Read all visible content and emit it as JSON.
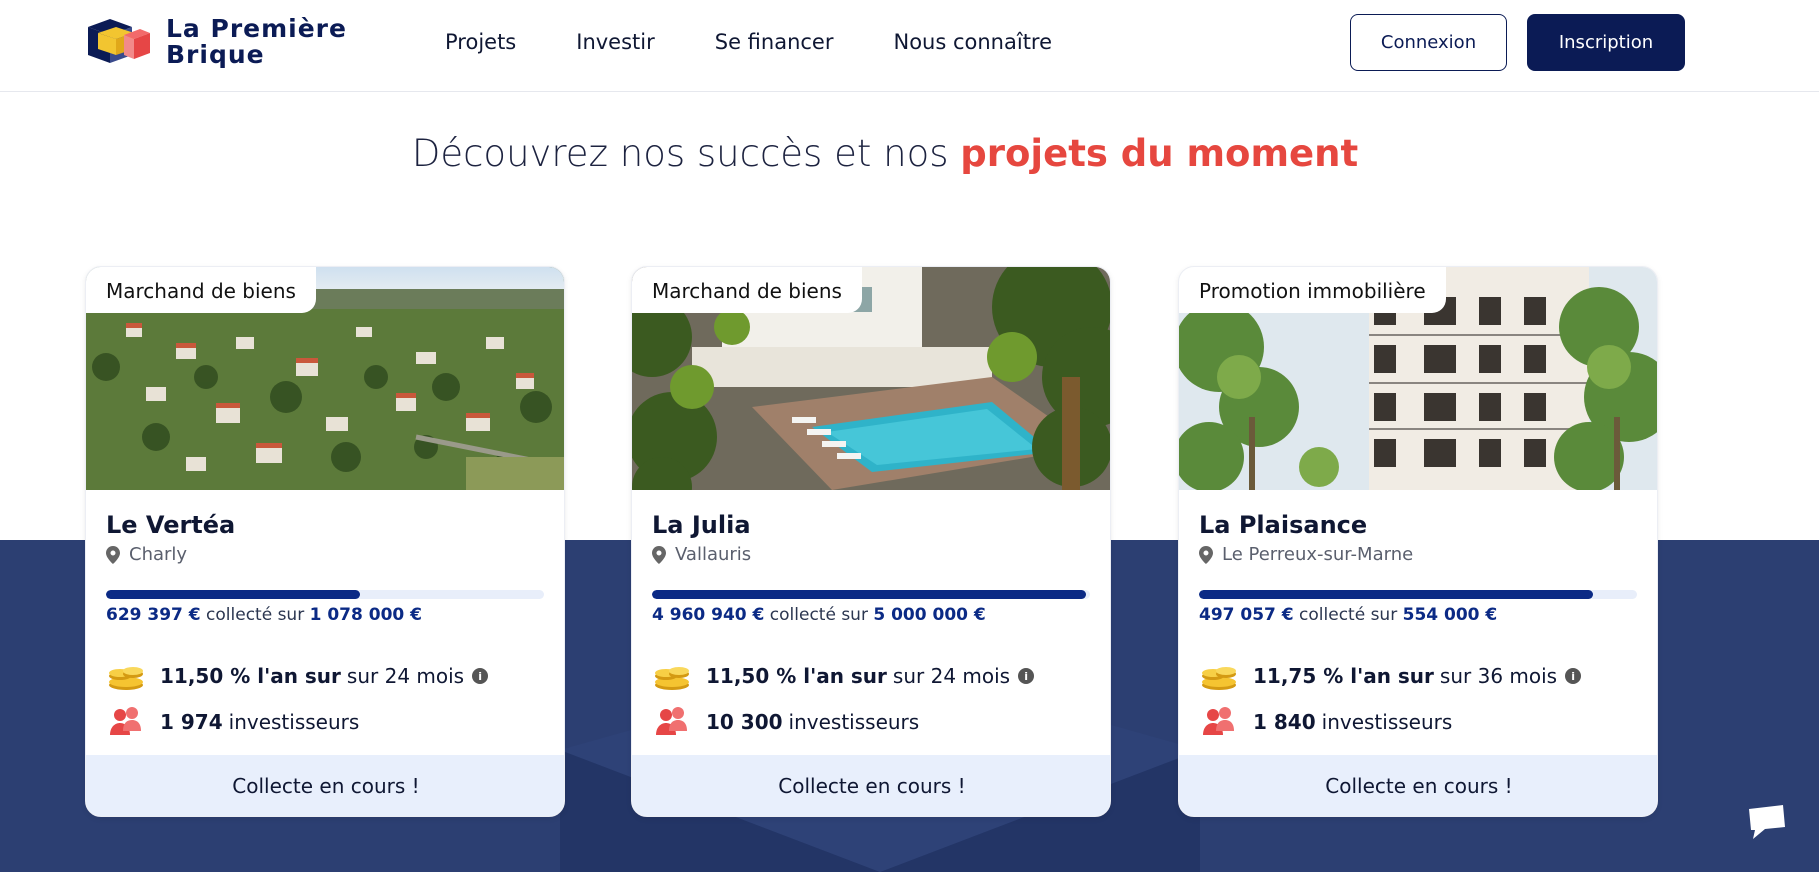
{
  "header": {
    "logo_line1": "La Première",
    "logo_line2": "Brique",
    "nav": [
      "Projets",
      "Investir",
      "Se financer",
      "Nous connaître"
    ],
    "login_label": "Connexion",
    "signup_label": "Inscription"
  },
  "headline": {
    "prefix": "Découvrez nos succès et nos ",
    "accent": "projets du moment"
  },
  "colors": {
    "navy": "#0b1b55",
    "accent_red": "#e6473f",
    "band_blue": "#2c3f72",
    "progress": "#0b2a85",
    "status_bg": "#e8effc"
  },
  "cards": [
    {
      "tag": "Marchand de biens",
      "title": "Le Vertéa",
      "location": "Charly",
      "collected": "629 397 €",
      "collected_mid": " collecté sur ",
      "goal": "1 078 000 €",
      "progress": 0.58,
      "rate": "11,50 % l'an sur",
      "duration": "sur 24 mois",
      "investors_count": "1 974",
      "investors_label": "investisseurs",
      "status": "Collecte en cours !"
    },
    {
      "tag": "Marchand de biens",
      "title": "La Julia",
      "location": "Vallauris",
      "collected": "4 960 940 €",
      "collected_mid": " collecté sur ",
      "goal": "5 000 000 €",
      "progress": 0.99,
      "rate": "11,50 % l'an sur",
      "duration": "sur 24 mois",
      "investors_count": "10 300",
      "investors_label": "investisseurs",
      "status": "Collecte en cours !"
    },
    {
      "tag": "Promotion immobilière",
      "title": "La Plaisance",
      "location": "Le Perreux-sur-Marne",
      "collected": "497 057 €",
      "collected_mid": " collecté sur ",
      "goal": "554 000 €",
      "progress": 0.9,
      "rate": "11,75 % l'an sur",
      "duration": "sur 36 mois",
      "investors_count": "1 840",
      "investors_label": "investisseurs",
      "status": "Collecte en cours !"
    }
  ],
  "icons": {
    "logo": "brick-cube-logo",
    "location": "map-pin-icon",
    "rate": "gold-coins-icon",
    "investors": "people-icon",
    "info": "info-icon",
    "chat": "chat-bubble-icon"
  }
}
